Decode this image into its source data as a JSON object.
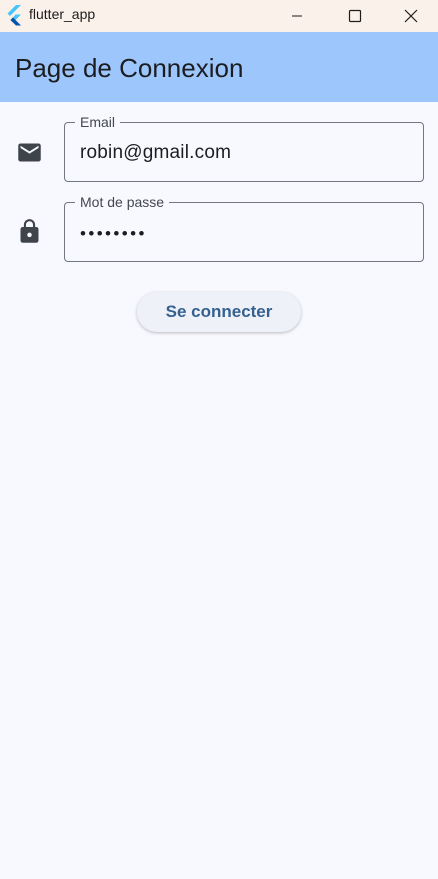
{
  "window": {
    "title": "flutter_app",
    "icon": "flutter-logo-icon",
    "controls": [
      "minimize-icon",
      "maximize-icon",
      "close-icon"
    ]
  },
  "appbar": {
    "title": "Page de Connexion",
    "color": "#9dc7fc"
  },
  "form": {
    "email": {
      "label": "Email",
      "value": "robin@gmail.com",
      "icon": "mail-icon"
    },
    "password": {
      "label": "Mot de passe",
      "value": "••••••••",
      "icon": "lock-icon"
    },
    "submit_label": "Se connecter"
  },
  "colors": {
    "background": "#f8f9fe",
    "titlebar": "#faf1ea",
    "button_text": "#35608f"
  }
}
